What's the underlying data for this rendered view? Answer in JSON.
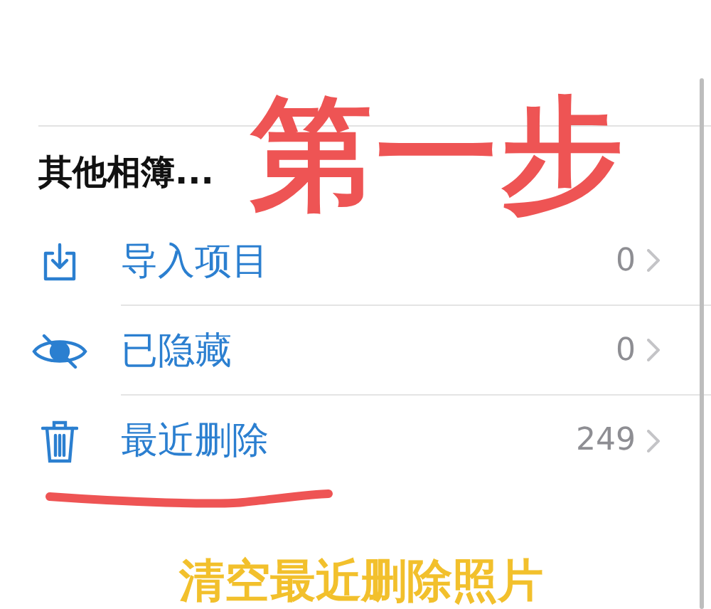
{
  "section": {
    "title": "其他相簿..."
  },
  "rows": [
    {
      "kind": "import",
      "label": "导入项目",
      "count": "0"
    },
    {
      "kind": "hidden",
      "label": "已隐藏",
      "count": "0"
    },
    {
      "kind": "trash",
      "label": "最近删除",
      "count": "249"
    }
  ],
  "annotations": {
    "step_label": "第一步",
    "caption": "清空最近删除照片"
  }
}
